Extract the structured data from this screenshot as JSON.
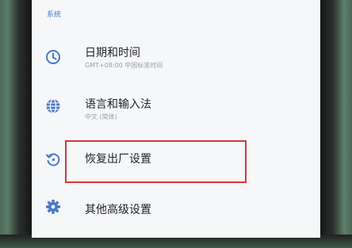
{
  "section_header": "系统",
  "items": [
    {
      "icon": "clock-icon",
      "title": "日期和时间",
      "subtitle": "GMT+08:00 中国标准时间"
    },
    {
      "icon": "globe-icon",
      "title": "语言和输入法",
      "subtitle": "中文 (简体)"
    },
    {
      "icon": "restore-icon",
      "title": "恢复出厂设置"
    },
    {
      "icon": "gear-icon",
      "title": "其他高级设置"
    }
  ],
  "accent_color": "#4a78c8",
  "highlight_color": "#d9363a"
}
